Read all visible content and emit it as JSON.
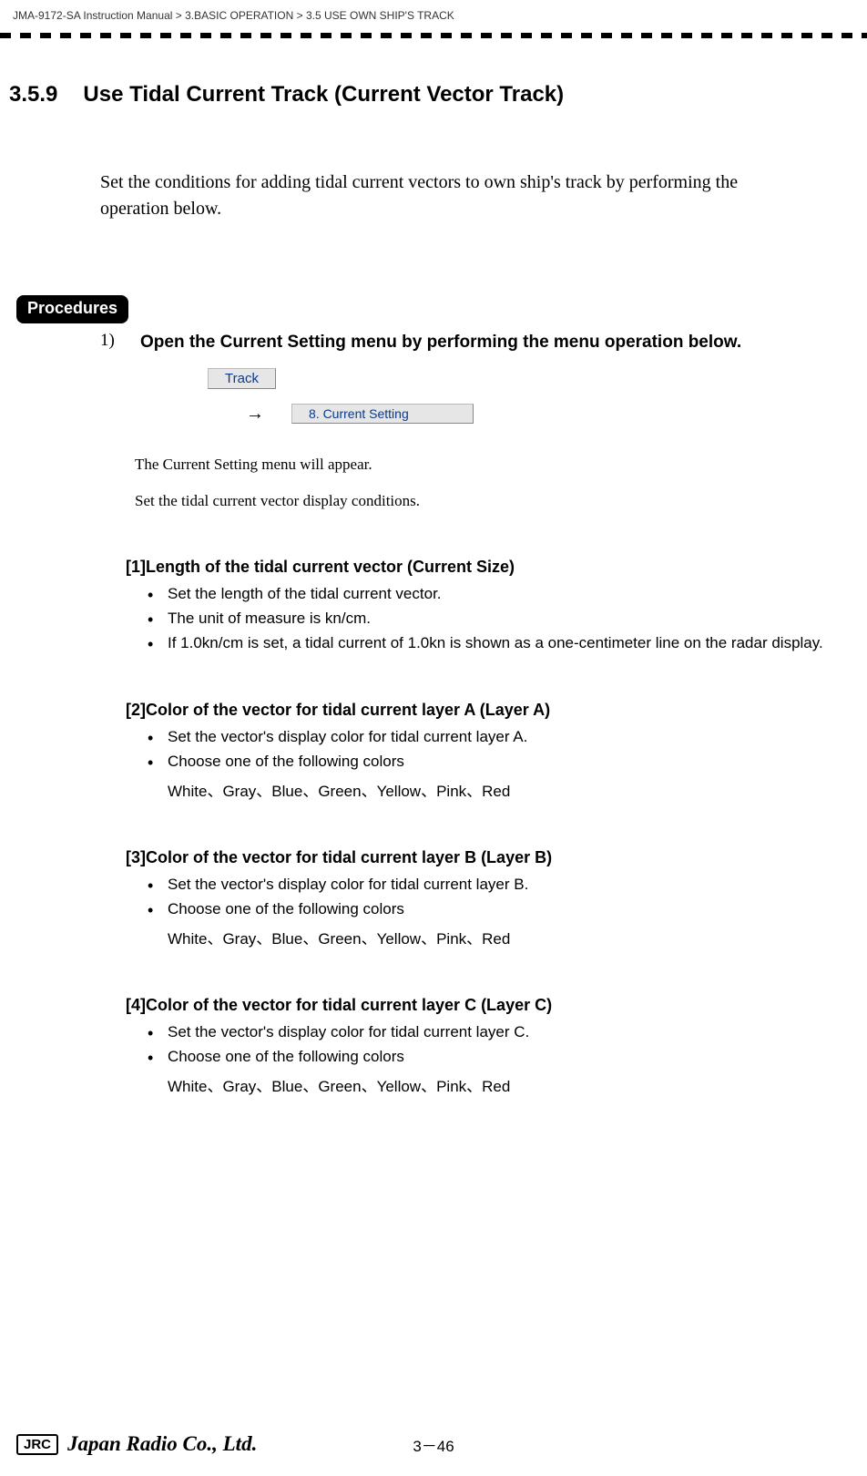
{
  "breadcrumb": {
    "p1": "JMA-9172-SA Instruction Manual",
    "sep": ">",
    "p2": "3.BASIC OPERATION",
    "p3": "3.5  USE OWN SHIP'S TRACK"
  },
  "heading": {
    "num": "3.5.9",
    "title": "Use Tidal Current Track (Current Vector Track)"
  },
  "intro": "Set the conditions for adding tidal current vectors to own ship's track by performing the operation below.",
  "procedures_label": "Procedures",
  "step1": {
    "num": "1)",
    "text": "Open the Current Setting menu by performing the menu operation below."
  },
  "menu": {
    "button": "Track",
    "arrow": "→",
    "item": "8. Current Setting"
  },
  "note1": "The Current Setting menu will appear.",
  "note2": "Set the tidal current vector display conditions.",
  "sub1": {
    "title": "[1]Length of the tidal current vector (Current Size)",
    "b1": "Set the length of the tidal current vector.",
    "b2": "The unit of measure is kn/cm.",
    "b3": "If 1.0kn/cm is set, a tidal current of 1.0kn is shown as a one-centimeter line on the radar display."
  },
  "sub2": {
    "title": "[2]Color of the vector for tidal current layer A (Layer A)",
    "b1": "Set the vector's display color for tidal current layer A.",
    "b2": "Choose one of the following colors",
    "colors": "White、Gray、Blue、Green、Yellow、Pink、Red"
  },
  "sub3": {
    "title": "[3]Color of the vector for tidal current layer B (Layer B)",
    "b1": "Set the vector's display color for tidal current layer B.",
    "b2": "Choose one of the following colors",
    "colors": "White、Gray、Blue、Green、Yellow、Pink、Red"
  },
  "sub4": {
    "title": "[4]Color of the vector for tidal current layer C (Layer C)",
    "b1": "Set the vector's display color for tidal current layer C.",
    "b2": "Choose one of the following colors",
    "colors": "White、Gray、Blue、Green、Yellow、Pink、Red"
  },
  "footer": {
    "badge": "JRC",
    "script": "Japan Radio Co., Ltd.",
    "page": "3－46"
  }
}
